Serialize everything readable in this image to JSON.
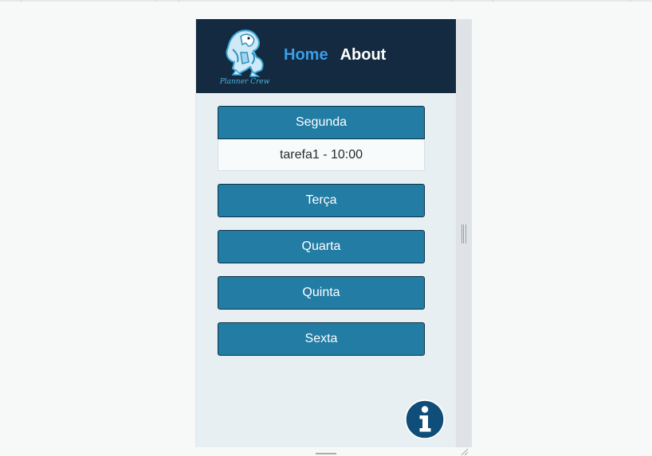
{
  "header": {
    "logo_text": "Planner Crew",
    "nav": [
      {
        "label": "Home",
        "active": true
      },
      {
        "label": "About",
        "active": false
      }
    ]
  },
  "days": [
    {
      "label": "Segunda",
      "expanded": true,
      "tasks": [
        "tarefa1 - 10:00"
      ]
    },
    {
      "label": "Terça",
      "expanded": false,
      "tasks": []
    },
    {
      "label": "Quarta",
      "expanded": false,
      "tasks": []
    },
    {
      "label": "Quinta",
      "expanded": false,
      "tasks": []
    },
    {
      "label": "Sexta",
      "expanded": false,
      "tasks": []
    }
  ],
  "info_button": {
    "icon": "info-icon"
  },
  "colors": {
    "header_bg": "#132a40",
    "nav_active": "#3a9ee8",
    "day_button_bg": "#227ca4",
    "app_bg": "#e7eff2",
    "info_bg": "#0f4e78"
  }
}
